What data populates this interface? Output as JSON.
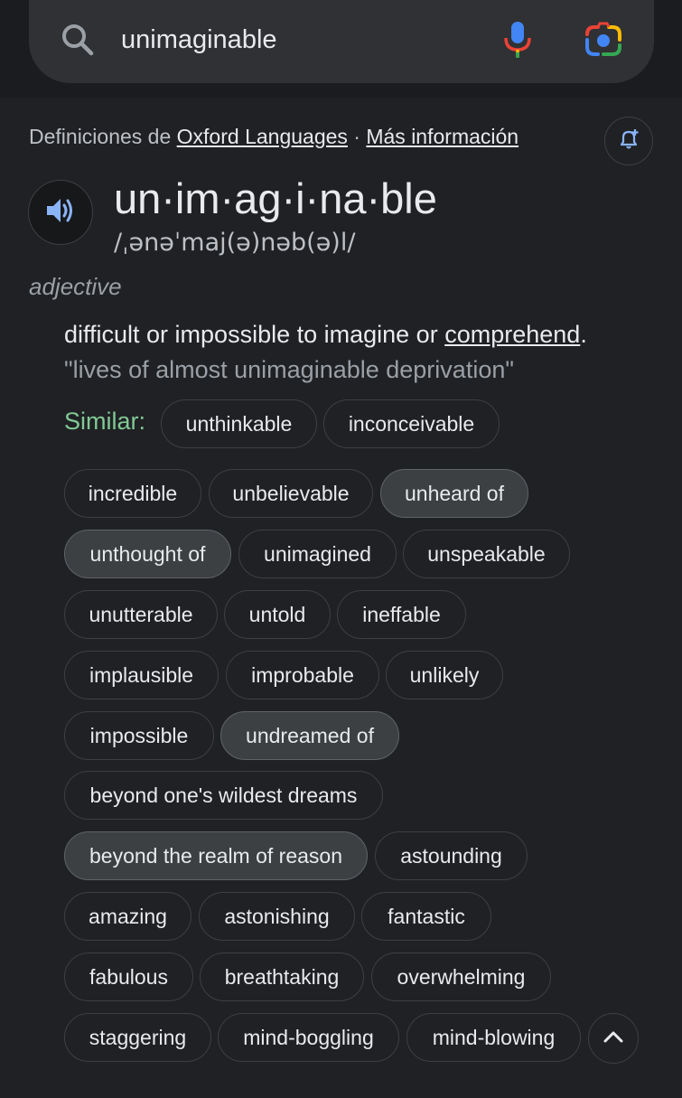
{
  "search": {
    "query": "unimaginable",
    "icons": [
      "search-icon",
      "mic-icon",
      "google-lens-icon"
    ]
  },
  "source": {
    "prefix": "Definiciones de",
    "provider": "Oxford Languages",
    "separator": "·",
    "more_info": "Más información"
  },
  "entry": {
    "word": "un·im·ag·i·na·ble",
    "phonetic": "/ˌənəˈmaj(ə)nəb(ə)l/",
    "part_of_speech": "adjective",
    "definition_text": "difficult or impossible to imagine or ",
    "definition_link": "comprehend",
    "definition_end": ".",
    "example": "\"lives of almost unimaginable deprivation\""
  },
  "similar": {
    "label": "Similar:",
    "chips": [
      {
        "label": "unthinkable",
        "selected": false
      },
      {
        "label": "inconceivable",
        "selected": false
      },
      {
        "label": "incredible",
        "selected": false
      },
      {
        "label": "unbelievable",
        "selected": false
      },
      {
        "label": "unheard of",
        "selected": true
      },
      {
        "label": "unthought of",
        "selected": true
      },
      {
        "label": "unimagined",
        "selected": false
      },
      {
        "label": "unspeakable",
        "selected": false
      },
      {
        "label": "unutterable",
        "selected": false
      },
      {
        "label": "untold",
        "selected": false
      },
      {
        "label": "ineffable",
        "selected": false
      },
      {
        "label": "implausible",
        "selected": false
      },
      {
        "label": "improbable",
        "selected": false
      },
      {
        "label": "unlikely",
        "selected": false
      },
      {
        "label": "impossible",
        "selected": false
      },
      {
        "label": "undreamed of",
        "selected": true
      },
      {
        "label": "beyond one's wildest dreams",
        "selected": false
      },
      {
        "label": "beyond the realm of reason",
        "selected": true
      },
      {
        "label": "astounding",
        "selected": false
      },
      {
        "label": "amazing",
        "selected": false
      },
      {
        "label": "astonishing",
        "selected": false
      },
      {
        "label": "fantastic",
        "selected": false
      },
      {
        "label": "fabulous",
        "selected": false
      },
      {
        "label": "breathtaking",
        "selected": false
      },
      {
        "label": "overwhelming",
        "selected": false
      },
      {
        "label": "staggering",
        "selected": false
      },
      {
        "label": "mind-boggling",
        "selected": false
      },
      {
        "label": "mind-blowing",
        "selected": false
      }
    ]
  },
  "colors": {
    "background": "#202124",
    "chip_border": "#3c4043",
    "chip_selected": "#3c4043",
    "similar_label": "#81c995",
    "mic_blue": "#4285f4",
    "mic_red": "#ea4335"
  }
}
